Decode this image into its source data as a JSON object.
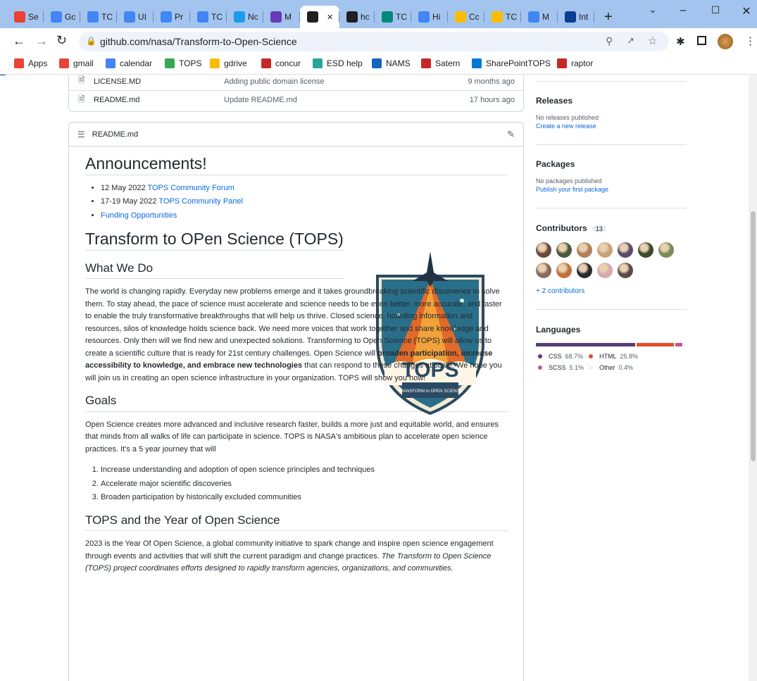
{
  "browser": {
    "tabs": [
      {
        "label": "Se",
        "color": "#ea4335"
      },
      {
        "label": "Gc",
        "color": "#4285f4"
      },
      {
        "label": "TC",
        "color": "#4285f4"
      },
      {
        "label": "UI",
        "color": "#4285f4"
      },
      {
        "label": "Pr",
        "color": "#4285f4"
      },
      {
        "label": "TC",
        "color": "#4285f4"
      },
      {
        "label": "Nc",
        "color": "#1d9bf0"
      },
      {
        "label": "M",
        "color": "#673ab7"
      },
      {
        "label": "",
        "color": "#1f1f1f"
      },
      {
        "label": "hc",
        "color": "#1f1f1f"
      },
      {
        "label": "TC",
        "color": "#00897b"
      },
      {
        "label": "Hi",
        "color": "#4285f4"
      },
      {
        "label": "Cc",
        "color": "#fbbc04"
      },
      {
        "label": "TC",
        "color": "#fbbc04"
      },
      {
        "label": "M",
        "color": "#4285f4"
      },
      {
        "label": "Int",
        "color": "#0b3d91"
      }
    ],
    "new_tab": "+",
    "url": "github.com/nasa/Transform-to-Open-Science",
    "bookmarks": [
      {
        "label": "Apps",
        "color": "#ea4335"
      },
      {
        "label": "gmail",
        "color": "#ea4335"
      },
      {
        "label": "calendar",
        "color": "#4285f4"
      },
      {
        "label": "TOPS",
        "color": "#34a853"
      },
      {
        "label": "gdrive",
        "color": "#fbbc04"
      },
      {
        "label": "concur",
        "color": "#c62828"
      },
      {
        "label": "ESD help",
        "color": "#26a69a"
      },
      {
        "label": "NAMS",
        "color": "#1565c0"
      },
      {
        "label": "Satern",
        "color": "#c62828"
      },
      {
        "label": "SharePointTOPS",
        "color": "#0078d4"
      },
      {
        "label": "raptor",
        "color": "#c62828"
      }
    ]
  },
  "files": [
    {
      "name": "LICENSE.MD",
      "message": "Adding public domain license",
      "age": "9 months ago"
    },
    {
      "name": "README.md",
      "message": "Update README.md",
      "age": "17 hours ago"
    }
  ],
  "readme": {
    "header": "README.md",
    "announcements_title": "Announcements!",
    "announcements": [
      {
        "prefix": "12 May 2022 ",
        "link": "TOPS Community Forum"
      },
      {
        "prefix": "17-19 May 2022 ",
        "link": "TOPS Community Panel"
      },
      {
        "prefix": "",
        "link": "Funding Opportunities"
      }
    ],
    "tops_title": "Transform to OPen Science (TOPS)",
    "what_title": "What We Do",
    "what_para_1": "The world is changing rapidly. Everyday new problems emerge and it takes groundbreaking scientific discoveries to solve them. To stay ahead, the pace of science must accelerate and science needs to be even better, more accurate, and faster to enable the truly transformative breakthroughs that will help us thrive. Closed science, hoarding information and resources, silos of knowledge holds science back. We need more voices that work together and share knowledge and resources. Only then will we find new and unexpected solutions. Transforming to Open Science (TOPS) will allow us to create a scientific culture that is ready for 21st century challenges. Open Science will ",
    "what_bold": "broaden participation, increase accessibility to knowledge, and embrace new technologies",
    "what_para_2": " that can respond to these changes at scale. We hope you will join us in creating an open science infrastructure in your organization. TOPS will show you how!",
    "logo_text": "TOPS",
    "logo_sub": "TRANSFORM to OPEN SCIENCE",
    "goals_title": "Goals",
    "goals_para": "Open Science creates more advanced and inclusive research faster, builds a more just and equitable world, and ensures that minds from all walks of life can participate in science. TOPS is NASA's ambitious plan to accelerate open science practices. It's a 5 year journey that will",
    "goals": [
      "Increase understanding and adoption of open science principles and techniques",
      "Accelerate major scientific discoveries",
      "Broaden participation by historically excluded communities"
    ],
    "year_title": "TOPS and the Year of Open Science",
    "year_para": "2023 is the Year Of Open Science, a global community initiative to spark change and inspire open science engagement through events and activities that will shift the current paradigm and change practices. ",
    "year_italic": "The Transform to Open Science (TOPS) project coordinates efforts designed to rapidly transform agencies, organizations, and communities."
  },
  "sidebar": {
    "releases_title": "Releases",
    "releases_none": "No releases published",
    "releases_link": "Create a new release",
    "packages_title": "Packages",
    "packages_none": "No packages published",
    "packages_link": "Publish your first package",
    "contributors_title": "Contributors",
    "contributors_count": "13",
    "contributors_more": "+ 2 contributors",
    "languages_title": "Languages",
    "languages": [
      {
        "name": "CSS",
        "percent": "68.7%",
        "value": 68.7,
        "color": "#563d7c"
      },
      {
        "name": "HTML",
        "percent": "25.8%",
        "value": 25.8,
        "color": "#e34c26"
      },
      {
        "name": "SCSS",
        "percent": "5.1%",
        "value": 5.1,
        "color": "#c6538c"
      },
      {
        "name": "Other",
        "percent": "0.4%",
        "value": 0.4,
        "color": "#ededed"
      }
    ]
  }
}
